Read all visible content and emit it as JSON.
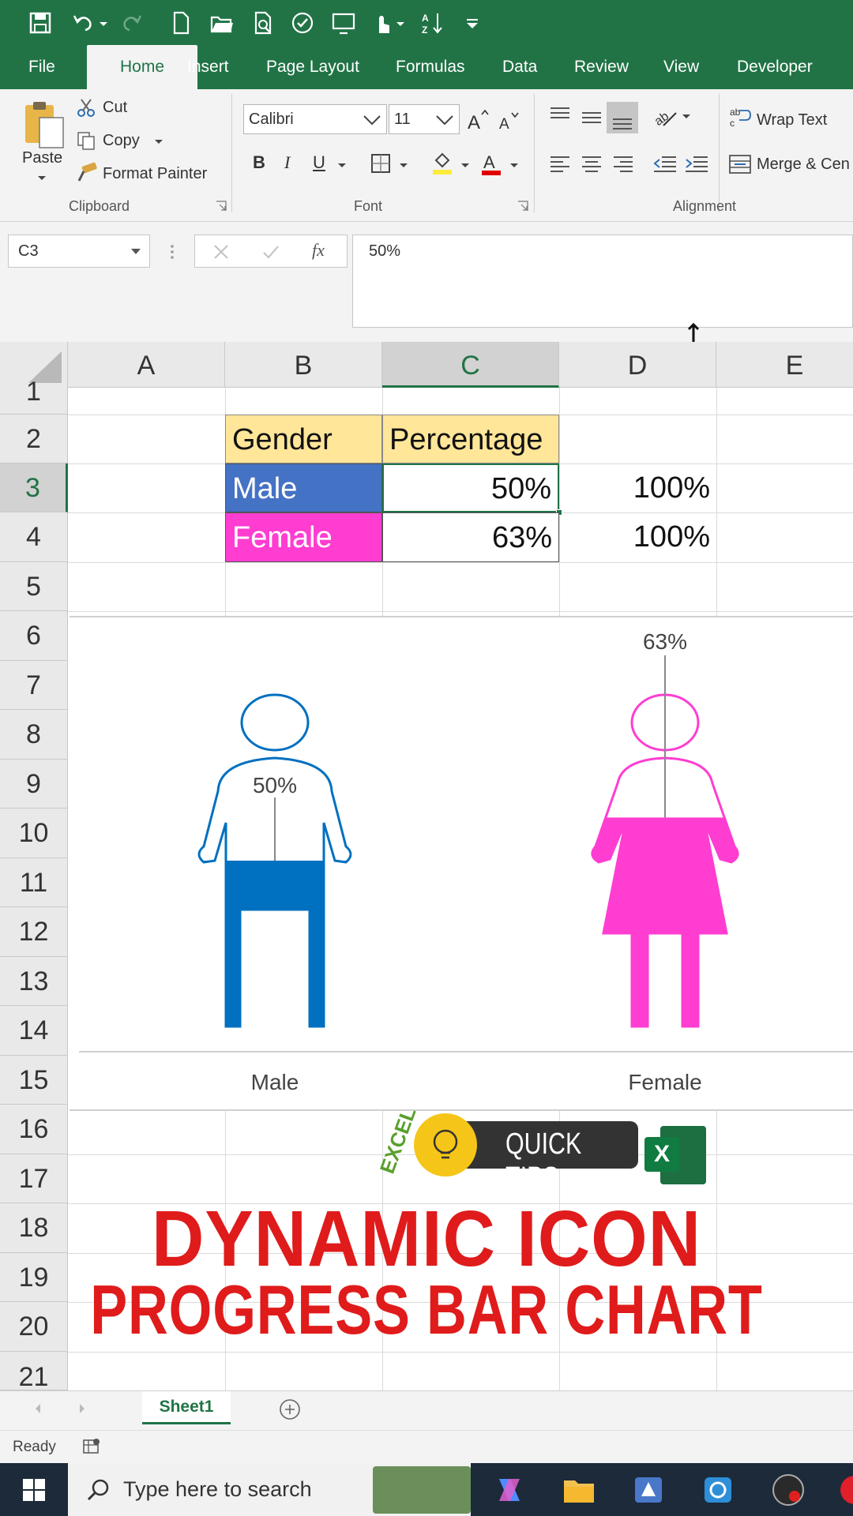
{
  "ribbon_tabs": [
    "File",
    "Home",
    "Insert",
    "Page Layout",
    "Formulas",
    "Data",
    "Review",
    "View",
    "Developer"
  ],
  "active_tab": "Home",
  "clipboard": {
    "paste": "Paste",
    "cut": "Cut",
    "copy": "Copy",
    "format_painter": "Format Painter",
    "group_label": "Clipboard"
  },
  "font": {
    "name": "Calibri",
    "size": "11",
    "group_label": "Font",
    "bold": "B",
    "italic": "I",
    "underline": "U"
  },
  "alignment": {
    "wrap_text": "Wrap Text",
    "merge_center": "Merge & Cen",
    "group_label": "Alignment"
  },
  "formula_bar": {
    "name_box": "C3",
    "fx": "fx",
    "content": "50%"
  },
  "columns": [
    "A",
    "B",
    "C",
    "D",
    "E"
  ],
  "selected_column": "C",
  "rows": [
    "1",
    "2",
    "3",
    "4",
    "5",
    "6",
    "7",
    "8",
    "9",
    "10",
    "11",
    "12",
    "13",
    "14",
    "15",
    "16",
    "17",
    "18",
    "19",
    "20",
    "21"
  ],
  "selected_row": "3",
  "table": {
    "headers": [
      "Gender",
      "Percentage"
    ],
    "rows": [
      {
        "gender": "Male",
        "percentage": "50%",
        "d": "100%"
      },
      {
        "gender": "Female",
        "percentage": "63%",
        "d": "100%"
      }
    ]
  },
  "colors": {
    "excel_green": "#217346",
    "header_fill": "#ffe699",
    "male_fill": "#4472c4",
    "female_fill": "#ff3dd1",
    "male_icon": "#0070c0",
    "female_icon": "#ff3dd1",
    "title_red": "#e01b1b"
  },
  "chart_data": {
    "type": "bar",
    "categories": [
      "Male",
      "Female"
    ],
    "values": [
      0.5,
      0.63
    ],
    "data_labels": [
      "50%",
      "63%"
    ],
    "ylim": [
      0,
      1
    ],
    "title": "",
    "xlabel": "",
    "ylabel": ""
  },
  "promo": {
    "badge_word": "EXCEL",
    "badge_text": "QUICK TIPS",
    "logo_letter": "X",
    "line1": "DYNAMIC ICON",
    "line2": "PROGRESS BAR CHART"
  },
  "sheet_tab": "Sheet1",
  "status": "Ready",
  "taskbar": {
    "search_placeholder": "Type here to search"
  }
}
